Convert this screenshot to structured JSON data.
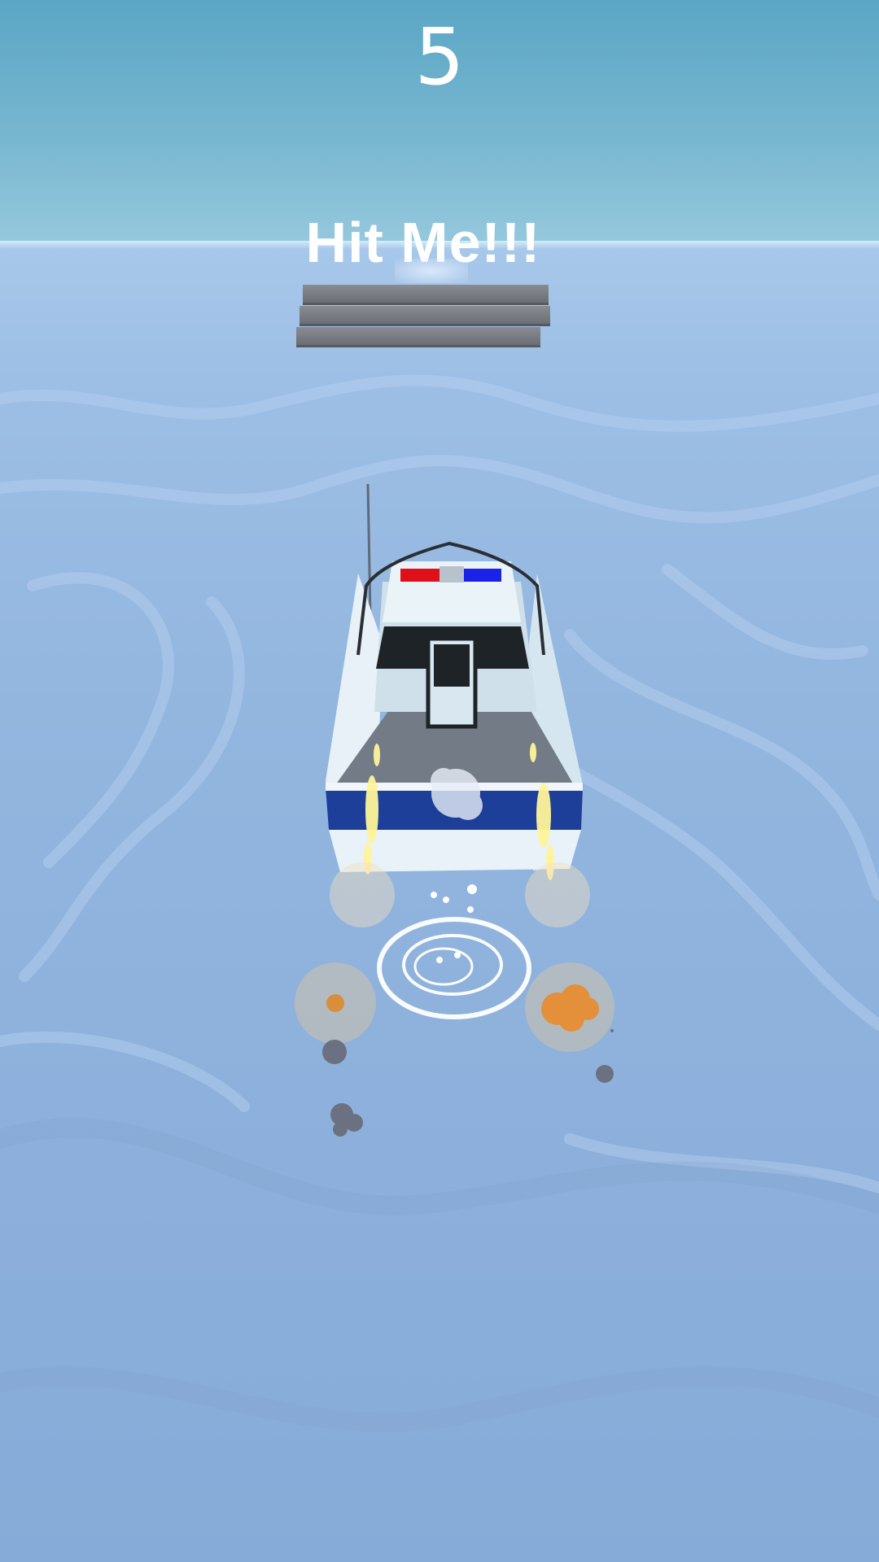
{
  "hud": {
    "score": "5",
    "target_label": "Hit Me!!!"
  },
  "colors": {
    "sky": "#5ea8c6",
    "water": "#8cb0db",
    "boat_hull_stripe": "#1d3f99",
    "siren_red": "#e0101a",
    "siren_blue": "#1a22e8",
    "flame": "#fff59a",
    "smoke": "#6b7180"
  }
}
